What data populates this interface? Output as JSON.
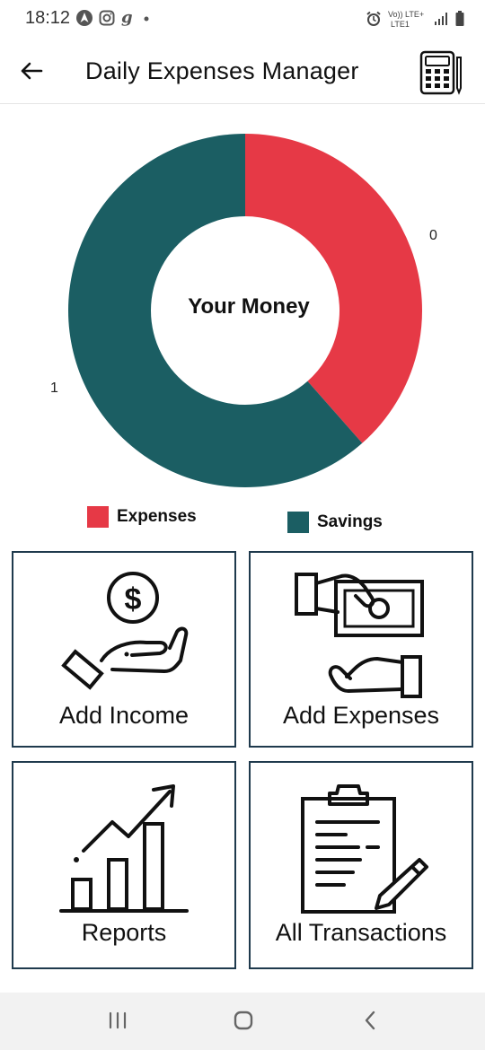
{
  "status_bar": {
    "time": "18:12",
    "left_icons": [
      "navigation-icon",
      "instagram-icon",
      "g-icon",
      "dot-icon"
    ],
    "right_icons": [
      "alarm-icon",
      "volte-icon",
      "signal-icon",
      "battery-icon"
    ],
    "network_label_top": "Vo)) LTE+",
    "network_label_bottom": "LTE1"
  },
  "header": {
    "title": "Daily Expenses Manager",
    "back_icon": "arrow-left-icon",
    "action_icon": "calculator-icon"
  },
  "chart_data": {
    "type": "pie",
    "center_text": "Your Money",
    "series": [
      {
        "name": "Expenses",
        "value": 0,
        "color": "#e63946",
        "fraction_shown": 0.385
      },
      {
        "name": "Savings",
        "value": 1,
        "color": "#1b5e63",
        "fraction_shown": 0.615
      }
    ],
    "slice_labels": [
      "0",
      "1"
    ],
    "legend": [
      "Expenses",
      "Savings"
    ]
  },
  "tiles": [
    {
      "label": "Add Income",
      "icon": "hand-coin-icon"
    },
    {
      "label": "Add Expenses",
      "icon": "hand-money-icon"
    },
    {
      "label": "Reports",
      "icon": "growth-chart-icon"
    },
    {
      "label": "All Transactions",
      "icon": "clipboard-list-icon"
    }
  ],
  "nav_bar": {
    "icons": [
      "recent-apps-icon",
      "home-icon",
      "back-icon"
    ]
  },
  "colors": {
    "expenses": "#e63946",
    "savings": "#1b5e63",
    "tile_border": "#1f3a4d"
  }
}
